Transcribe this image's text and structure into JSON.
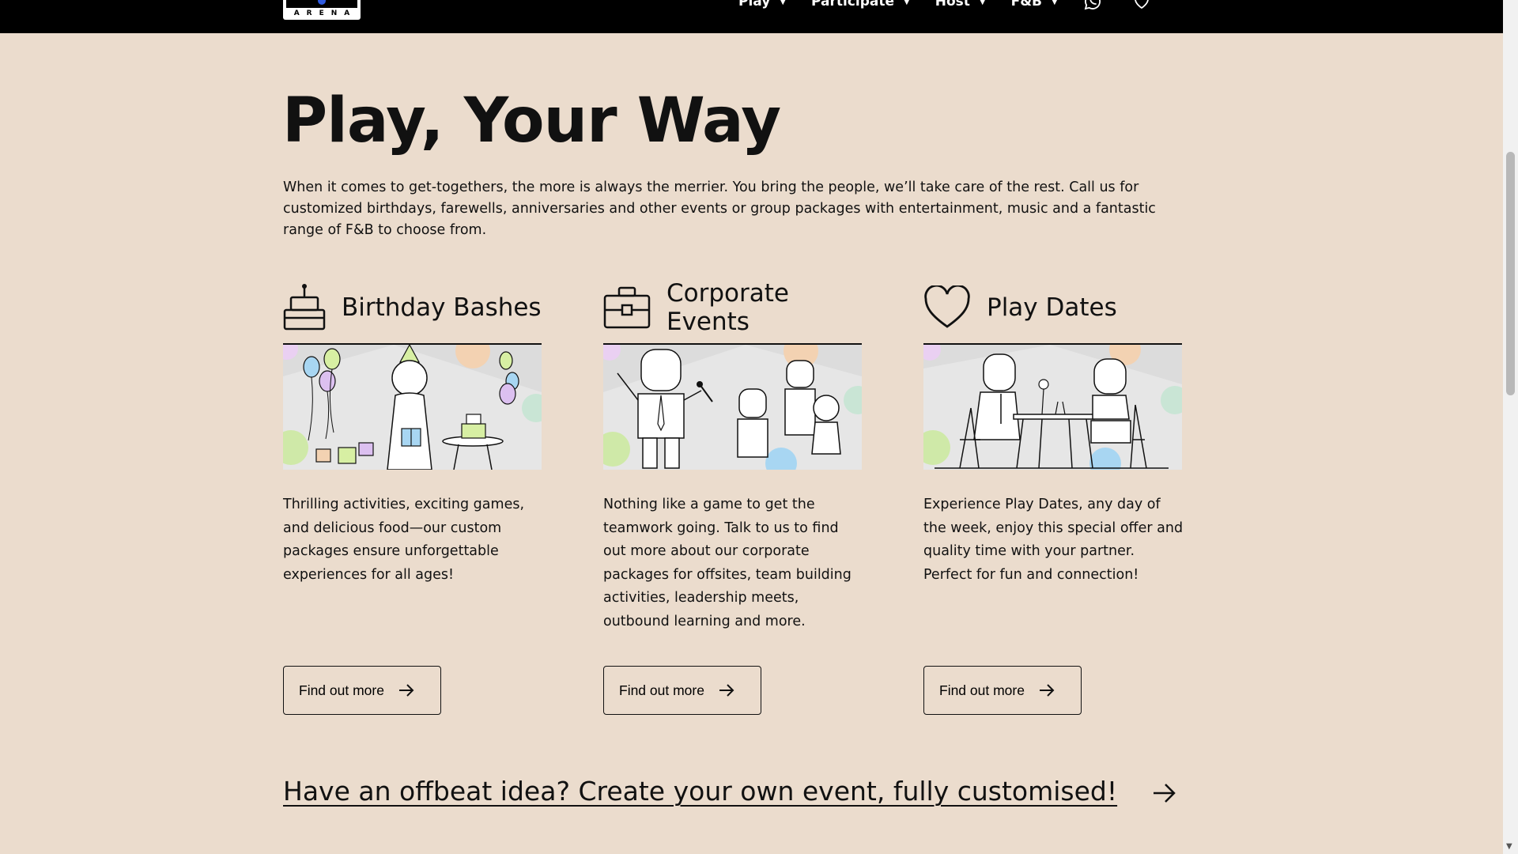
{
  "header": {
    "logo_text": "ARENA",
    "nav": [
      {
        "label": "Play"
      },
      {
        "label": "Participate"
      },
      {
        "label": "Host"
      },
      {
        "label": "F&B"
      }
    ],
    "icons": [
      "whatsapp-icon",
      "heart-icon"
    ]
  },
  "main": {
    "title": "Play, Your Way",
    "intro": "When it comes to get-togethers, the more is always the merrier. You bring the people, we’ll take care of the rest. Call us for customized birthdays, farewells, anniversaries and other events or group packages with entertainment, music and a fantastic range of F&B to choose from.",
    "cards": [
      {
        "title": "Birthday Bashes",
        "icon": "cake-icon",
        "description": "Thrilling activities, exciting games, and delicious food—our custom packages ensure unforgettable experiences for all ages!",
        "button": "Find out more"
      },
      {
        "title": "Corporate Events",
        "icon": "briefcase-icon",
        "description": "Nothing like a game to get the teamwork going. Talk to us to find out more about our corporate packages for offsites, team building activities, leadership meets, outbound learning and more.",
        "button": "Find out more"
      },
      {
        "title": "Play Dates",
        "icon": "heart-icon",
        "description": "Experience Play Dates, any day of the week, enjoy this special offer and quality time with your partner. Perfect for fun and connection!",
        "button": "Find out more"
      }
    ],
    "offbeat_link": "Have an offbeat idea? Create your own event, fully customised!"
  },
  "colors": {
    "background": "#ebdccd",
    "header": "#000000",
    "text": "#111111"
  }
}
